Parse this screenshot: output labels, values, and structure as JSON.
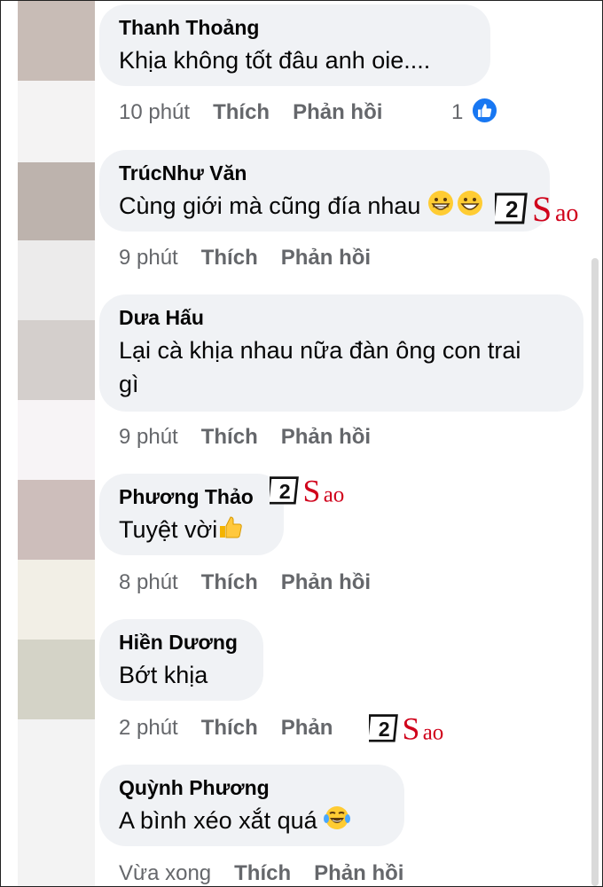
{
  "comments": [
    {
      "name": "Thanh Thoảng",
      "text": "Khịa không tốt đâu anh oie....",
      "time": "10 phút",
      "like_label": "Thích",
      "reply_label": "Phản hồi",
      "like_count": "1"
    },
    {
      "name": "TrúcNhư Văn",
      "text": "Cùng giới mà cũng đía nhau",
      "time": "9 phút",
      "like_label": "Thích",
      "reply_label": "Phản hồi"
    },
    {
      "name": "Dưa Hấu",
      "text": "Lại cà khịa nhau nữa đàn ông con trai gì",
      "time": "9 phút",
      "like_label": "Thích",
      "reply_label": "Phản hồi"
    },
    {
      "name": "Phương Thảo",
      "text": "Tuyệt vời",
      "time": "8 phút",
      "like_label": "Thích",
      "reply_label": "Phản hồi"
    },
    {
      "name": "Hiền Dương",
      "text": "Bớt khịa",
      "time": "2 phút",
      "like_label": "Thích",
      "reply_label": "Phản"
    },
    {
      "name": "Quỳnh Phương",
      "text": "A bình xéo xắt quá",
      "time": "Vừa xong",
      "like_label": "Thích",
      "reply_label": "Phản hồi"
    }
  ],
  "watermark": {
    "digit": "2",
    "word": "Sao"
  },
  "colors": {
    "bubble": "#f0f2f5",
    "meta": "#65676b",
    "like_blue": "#1877f2",
    "watermark_red": "#d0021b"
  },
  "icons": {
    "like": "thumbs-up-icon",
    "grin": "grinning-emoji-icon",
    "thumb": "thumbs-up-emoji-icon",
    "laugh": "tears-of-joy-emoji-icon"
  }
}
